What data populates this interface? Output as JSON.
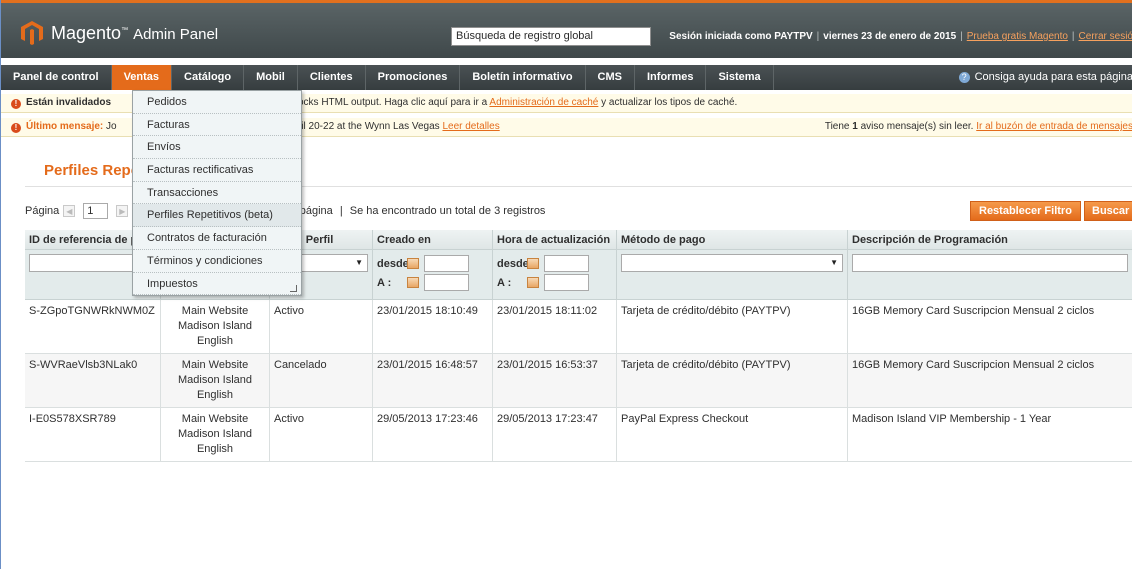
{
  "header": {
    "logo_text": "Magento",
    "logo_sub": "Admin Panel",
    "search_value": "Búsqueda de registro global",
    "session_text": "Sesión iniciada como PAYTPV",
    "date_text": "viernes 23 de enero de 2015",
    "trial_link": "Prueba gratis Magento",
    "logout_link": "Cerrar sesió"
  },
  "nav": {
    "items": [
      "Panel de control",
      "Ventas",
      "Catálogo",
      "Mobil",
      "Clientes",
      "Promociones",
      "Boletín informativo",
      "CMS",
      "Informes",
      "Sistema"
    ],
    "help": "Consiga ayuda para esta página",
    "active_color": "#e46b1b"
  },
  "notices": {
    "n1_strong": "Están invalidados",
    "n1_text": "ocks HTML output. Haga clic aquí para ir a",
    "n1_link": "Administración de caché",
    "n1_text2": "y actualizar los tipos de caché.",
    "n2_strong": "Último mensaje:",
    "n2_pre": "Jo",
    "n2_text": "ril 20-22 at the Wynn Las Vegas",
    "n2_link": "Leer detalles",
    "n2_right": "Tiene",
    "n2_right_count": "1",
    "n2_right_text": "aviso mensaje(s) sin leer.",
    "n2_right_link": "Ir al buzón de entrada de mensajes"
  },
  "page": {
    "title": "Perfiles Repet"
  },
  "pager": {
    "label": "Página",
    "page": "1",
    "per_page_text": "r página",
    "sep": "|",
    "total_text": "Se ha encontrado un total de 3 registros",
    "reset_button": "Restablecer Filtro",
    "search_button": "Buscar"
  },
  "grid": {
    "headers": [
      "ID de referencia de pa",
      "",
      "lo del Perfil",
      "Creado en",
      "Hora de actualización",
      "Método de pago",
      "Descripción de Programación"
    ],
    "range_from": "desde",
    "range_to": "A :",
    "rows": [
      {
        "id": "S-ZGpoTGNWRkNWM0Z",
        "store1": "Main Website",
        "store2": "Madison Island",
        "store3": "English",
        "status": "Activo",
        "created": "23/01/2015 18:10:49",
        "updated": "23/01/2015 18:11:02",
        "method": "Tarjeta de crédito/débito (PAYTPV)",
        "desc": "16GB Memory Card Suscripcion Mensual 2 ciclos"
      },
      {
        "id": "S-WVRaeVlsb3NLak0",
        "store1": "Main Website",
        "store2": "Madison Island",
        "store3": "English",
        "status": "Cancelado",
        "created": "23/01/2015 16:48:57",
        "updated": "23/01/2015 16:53:37",
        "method": "Tarjeta de crédito/débito (PAYTPV)",
        "desc": "16GB Memory Card Suscripcion Mensual 2 ciclos"
      },
      {
        "id": "I-E0S578XSR789",
        "store1": "Main Website",
        "store2": "Madison Island",
        "store3": "English",
        "status": "Activo",
        "created": "29/05/2013 17:23:46",
        "updated": "29/05/2013 17:23:47",
        "method": "PayPal Express Checkout",
        "desc": "Madison Island VIP Membership - 1 Year"
      }
    ]
  },
  "dropdown": {
    "items": [
      "Pedidos",
      "Facturas",
      "Envíos",
      "Facturas rectificativas",
      "Transacciones",
      "Perfiles Repetitivos (beta)",
      "Contratos de facturación",
      "Términos y condiciones",
      "Impuestos"
    ]
  }
}
